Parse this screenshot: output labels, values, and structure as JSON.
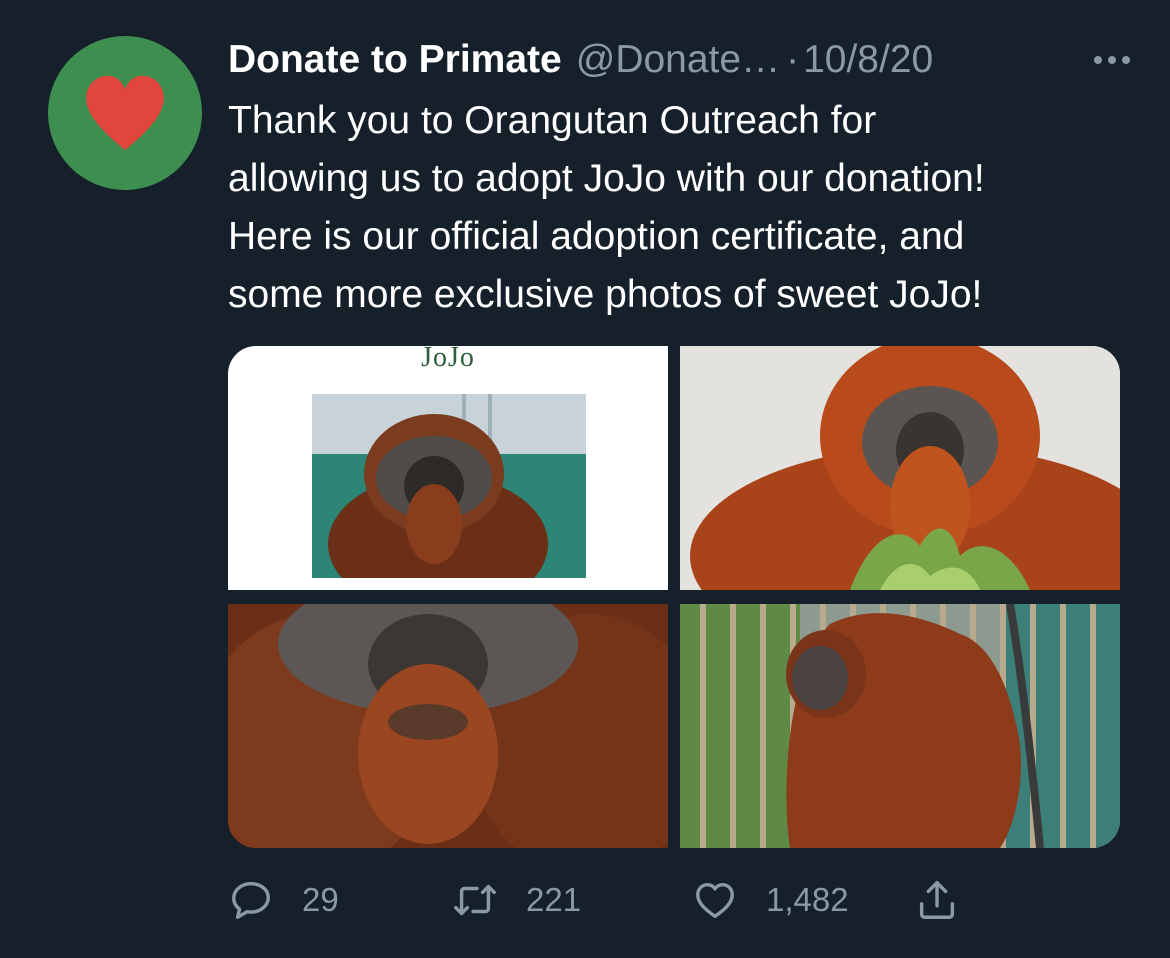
{
  "author": {
    "name": "Donate to Primate",
    "handle": "@Donate…",
    "separator": "·",
    "date": "10/8/20",
    "avatar_icon": "heart-icon",
    "avatar_color": "#3e8e4f",
    "heart_color": "#e0463d"
  },
  "tweet": {
    "lines": [
      "Thank you to Orangutan Outreach for",
      "allowing us to adopt JoJo with our donation!",
      "Here is our official adoption certificate, and",
      "some more exclusive photos of sweet JoJo!"
    ]
  },
  "media": {
    "certificate_title": "JoJo"
  },
  "actions": {
    "reply": {
      "icon": "reply-icon",
      "count": "29"
    },
    "retweet": {
      "icon": "retweet-icon",
      "count": "221"
    },
    "like": {
      "icon": "heart-outline-icon",
      "count": "1,482"
    },
    "share": {
      "icon": "share-icon"
    }
  },
  "colors": {
    "background": "#15202b",
    "muted_text": "#8b98a5",
    "primary_text": "#ffffff"
  }
}
